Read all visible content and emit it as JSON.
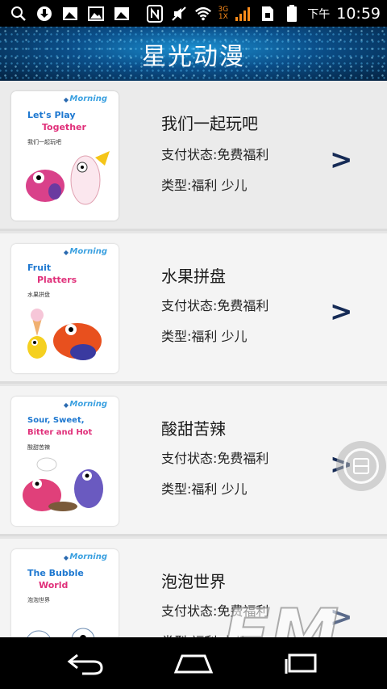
{
  "status_bar": {
    "time": "10:59",
    "am_pm": "下午",
    "network_top": "3G",
    "network_bottom": "1X"
  },
  "header": {
    "title": "星光动漫"
  },
  "items": [
    {
      "name": "我们一起玩吧",
      "pay_status": "支付状态:免费福利",
      "type": "类型:福利 少儿",
      "cover": {
        "title_lines": [
          "Let's Play",
          "Together"
        ],
        "subtitle": "我们一起玩吧",
        "logo": "Morning"
      }
    },
    {
      "name": "水果拼盘",
      "pay_status": "支付状态:免费福利",
      "type": "类型:福利 少儿",
      "cover": {
        "title_lines": [
          "Fruit",
          "Platters"
        ],
        "subtitle": "水果拼盘",
        "logo": "Morning"
      }
    },
    {
      "name": "酸甜苦辣",
      "pay_status": "支付状态:免费福利",
      "type": "类型:福利 少儿",
      "cover": {
        "title_lines": [
          "Sour, Sweet,",
          "Bitter and Hot"
        ],
        "subtitle": "酸甜苦辣",
        "logo": "Morning"
      }
    },
    {
      "name": "泡泡世界",
      "pay_status": "支付状态:免费福利",
      "type": "类型:福利 少儿",
      "cover": {
        "title_lines": [
          "The Bubble",
          "World"
        ],
        "subtitle": "泡泡世界",
        "logo": "Morning"
      }
    }
  ],
  "chevron": ">",
  "watermark": {
    "text": "FM",
    "subtext": "4399"
  },
  "colors": {
    "header_blue": "#0b4f8a",
    "chevron": "#152a55",
    "list_bg": "#f4f4f4",
    "cover_title": "#1e78d0"
  }
}
